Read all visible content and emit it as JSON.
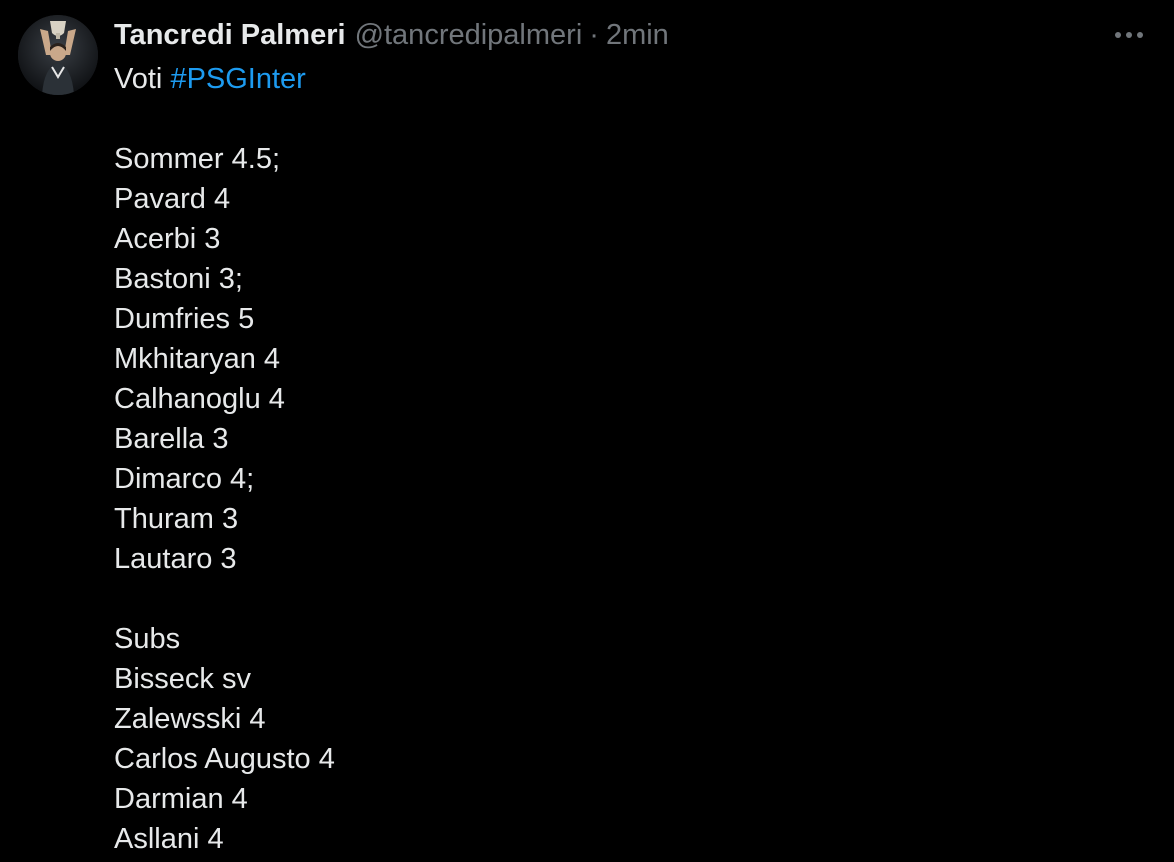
{
  "tweet": {
    "author": {
      "display_name": "Tancredi Palmeri",
      "handle": "@tancredipalmeri",
      "separator": "·",
      "timestamp": "2min",
      "avatar_icon": "user-avatar"
    },
    "more_icon": "more-horizontal-icon",
    "intro_text": "Voti ",
    "hashtag": "#PSGInter",
    "hashtag_color": "#1d9bf0",
    "ratings": [
      "Sommer 4.5;",
      "Pavard 4",
      "Acerbi 3",
      "Bastoni 3;",
      "Dumfries 5",
      "Mkhitaryan 4",
      "Calhanoglu 4",
      "Barella 3",
      "Dimarco 4;",
      "Thuram 3",
      "Lautaro 3"
    ],
    "subs_heading": "Subs",
    "subs": [
      "Bisseck sv",
      "Zalewsski 4",
      "Carlos Augusto 4",
      "Darmian 4",
      "Asllani 4"
    ]
  },
  "colors": {
    "background": "#000000",
    "text_primary": "#e7e9ea",
    "text_secondary": "#71767b",
    "accent": "#1d9bf0"
  }
}
